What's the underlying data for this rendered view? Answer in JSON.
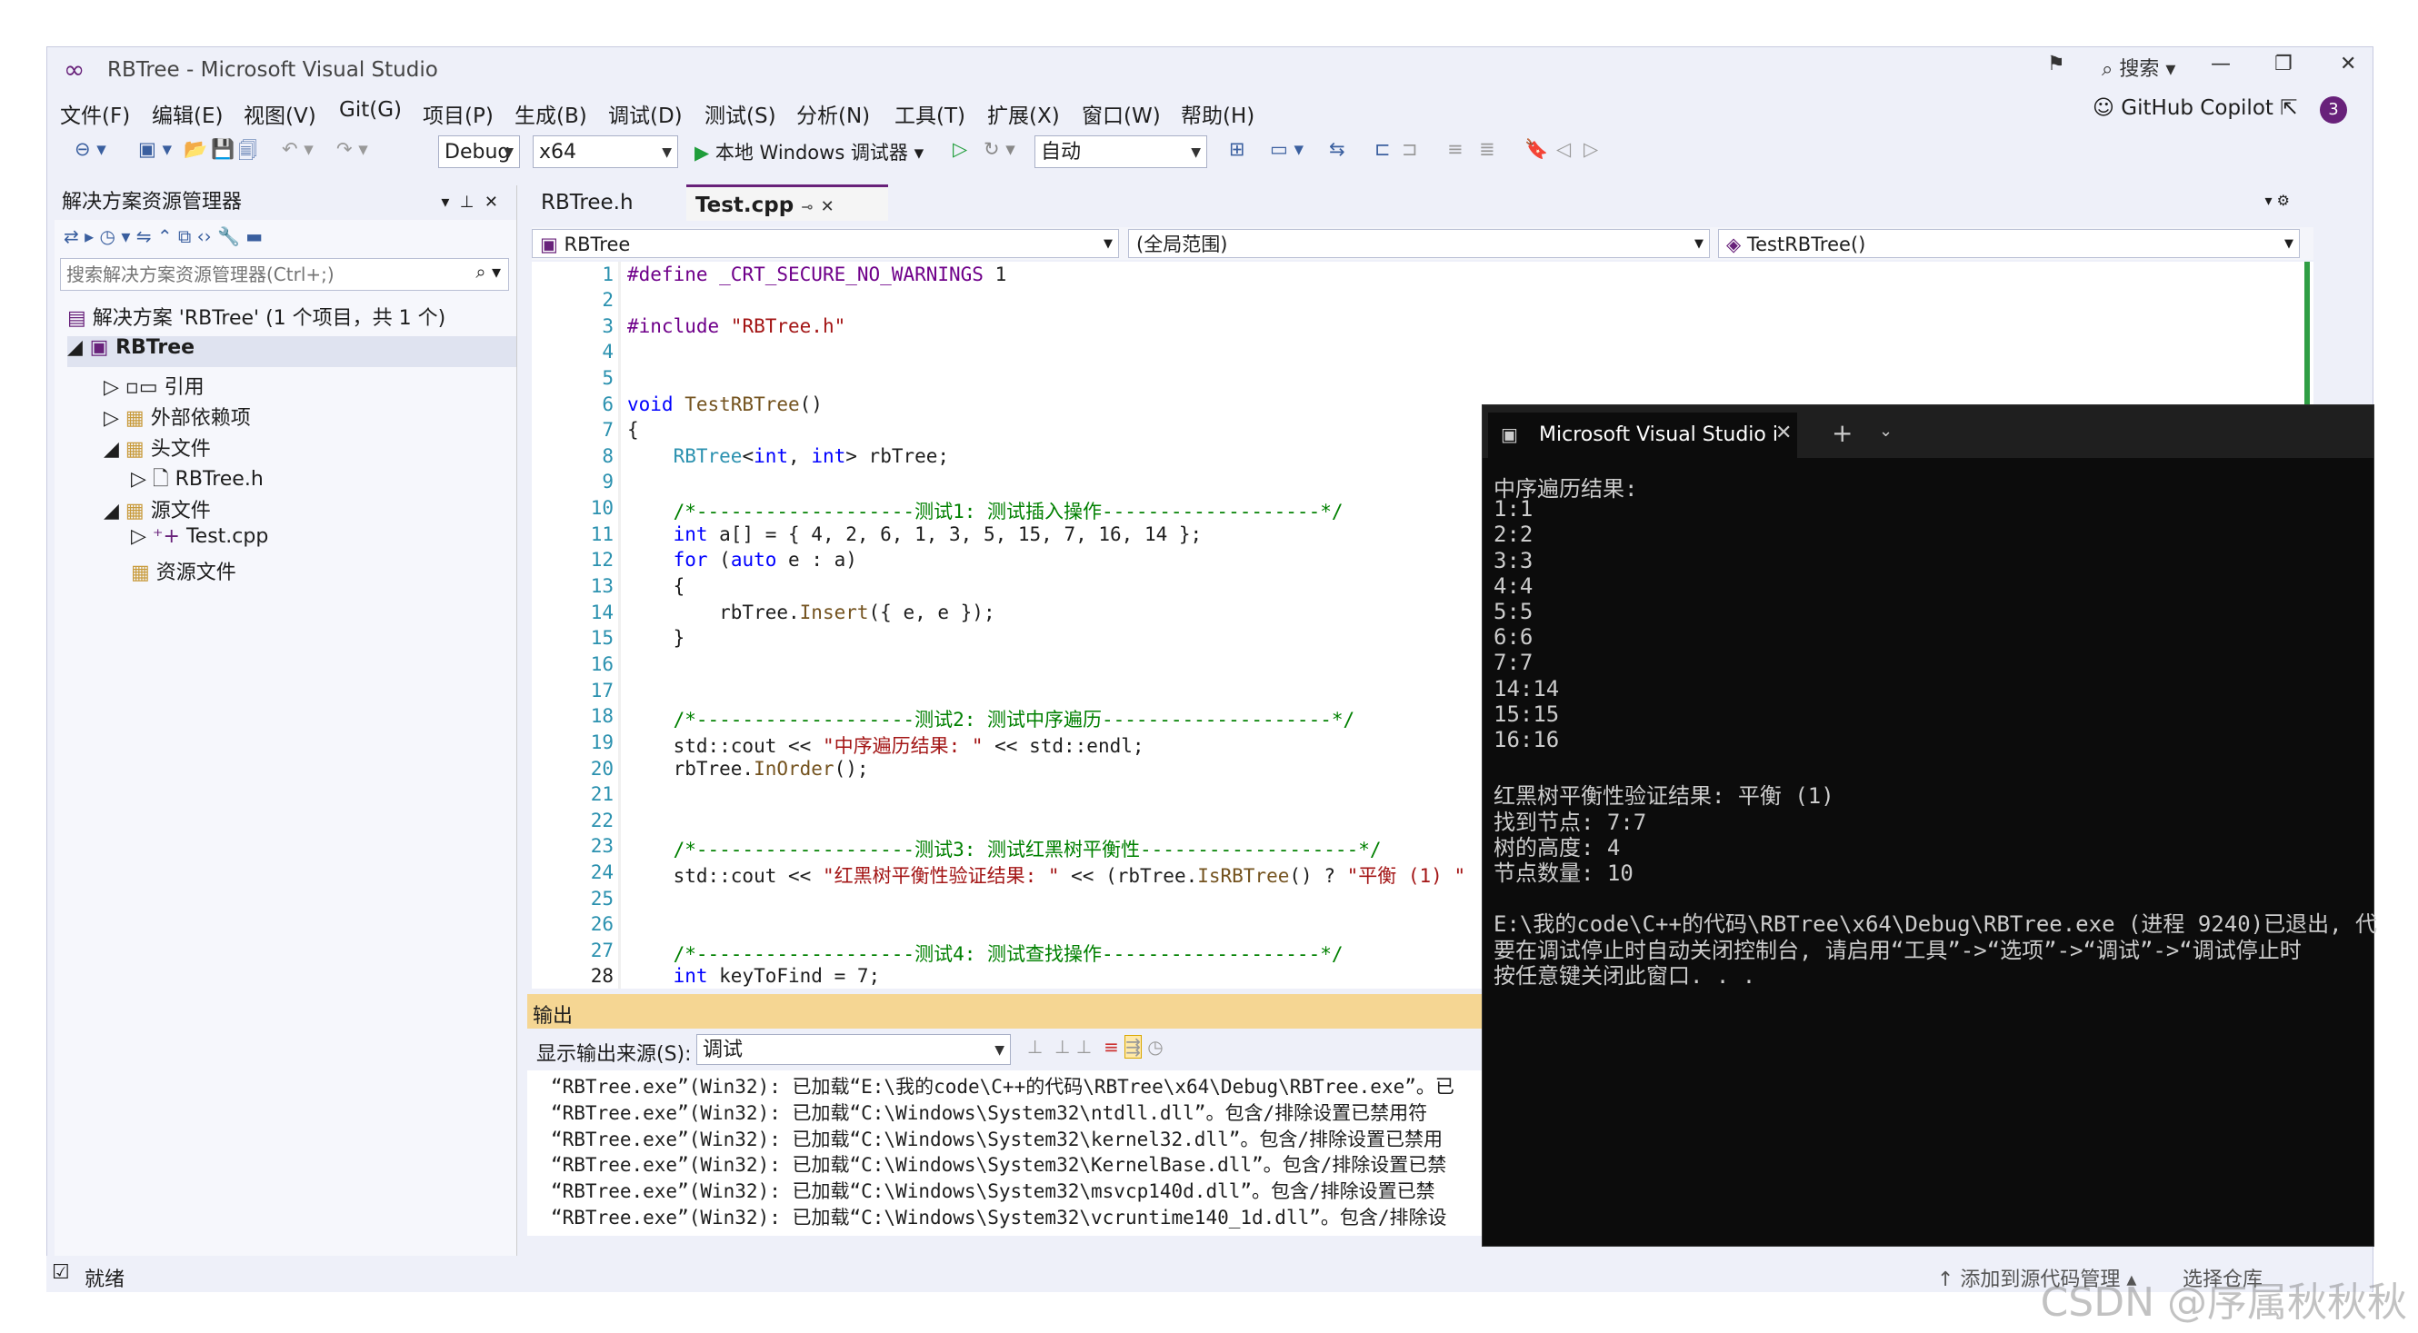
{
  "window": {
    "title": "RBTree - Microsoft Visual Studio",
    "search_label": "搜索",
    "copilot_label": "GitHub Copilot",
    "notification_count": "3",
    "minimize": "—",
    "restore": "❐",
    "close": "✕"
  },
  "menu": [
    "文件(F)",
    "编辑(E)",
    "视图(V)",
    "Git(G)",
    "项目(P)",
    "生成(B)",
    "调试(D)",
    "测试(S)",
    "分析(N)",
    "工具(T)",
    "扩展(X)",
    "窗口(W)",
    "帮助(H)"
  ],
  "toolbar": {
    "config": "Debug",
    "platform": "x64",
    "run_label": "本地 Windows 调试器",
    "auto_combo": "自动"
  },
  "solution_explorer": {
    "title": "解决方案资源管理器",
    "search_placeholder": "搜索解决方案资源管理器(Ctrl+;)",
    "items": [
      {
        "label": "解决方案 'RBTree' (1 个项目，共 1 个)"
      },
      {
        "label": "RBTree"
      },
      {
        "label": "引用"
      },
      {
        "label": "外部依赖项"
      },
      {
        "label": "头文件"
      },
      {
        "label": "RBTree.h"
      },
      {
        "label": "源文件"
      },
      {
        "label": "Test.cpp"
      },
      {
        "label": "资源文件"
      }
    ]
  },
  "editor": {
    "tabs": [
      {
        "label": "RBTree.h",
        "active": false
      },
      {
        "label": "Test.cpp",
        "active": true
      }
    ],
    "nav": {
      "project": "RBTree",
      "scope": "(全局范围)",
      "member": "TestRBTree()"
    },
    "line_numbers": [
      "1",
      "2",
      "3",
      "4",
      "5",
      "6",
      "7",
      "8",
      "9",
      "10",
      "11",
      "12",
      "13",
      "14",
      "15",
      "16",
      "17",
      "18",
      "19",
      "20",
      "21",
      "22",
      "23",
      "24",
      "25",
      "26",
      "27",
      "28"
    ],
    "code": {
      "l1a": "#define ",
      "l1b": "_CRT_SECURE_NO_WARNINGS",
      "l1c": " 1",
      "l3a": "#include ",
      "l3b": "\"RBTree.h\"",
      "l6a": "void ",
      "l6b": "TestRBTree",
      "l6c": "()",
      "l7": "{",
      "l8a": "    RBTree",
      "l8b": "<",
      "l8c": "int",
      "l8d": ", ",
      "l8e": "int",
      "l8f": "> rbTree;",
      "l10": "    /*-------------------测试1: 测试插入操作-------------------*/",
      "l11a": "    ",
      "l11b": "int",
      "l11c": " a[] = { 4, 2, 6, 1, 3, 5, 15, 7, 16, 14 };",
      "l12a": "    ",
      "l12b": "for",
      "l12c": " (",
      "l12d": "auto",
      "l12e": " e : a)",
      "l13": "    {",
      "l14a": "        rbTree.",
      "l14b": "Insert",
      "l14c": "({ e, e });",
      "l15": "    }",
      "l18": "    /*-------------------测试2: 测试中序遍历--------------------*/",
      "l19a": "    std::cout << ",
      "l19b": "\"中序遍历结果: \"",
      "l19c": " << std::endl;",
      "l20a": "    rbTree.",
      "l20b": "InOrder",
      "l20c": "();",
      "l23": "    /*-------------------测试3: 测试红黑树平衡性-------------------*/",
      "l24a": "    std::cout << ",
      "l24b": "\"红黑树平衡性验证结果: \"",
      "l24c": " << (rbTree.",
      "l24d": "IsRBTree",
      "l24e": "() ? ",
      "l24f": "\"平衡 (1) \"",
      "l27": "    /*-------------------测试4: 测试查找操作-------------------*/",
      "l28a": "    ",
      "l28b": "int",
      "l28c": " keyToFind = 7;"
    }
  },
  "output": {
    "title": "输出",
    "source_label": "显示输出来源(S):",
    "source_value": "调试",
    "lines": [
      "“RBTree.exe”(Win32): 已加载“E:\\我的code\\C++的代码\\RBTree\\x64\\Debug\\RBTree.exe”。已",
      "“RBTree.exe”(Win32): 已加载“C:\\Windows\\System32\\ntdll.dll”。包含/排除设置已禁用符",
      "“RBTree.exe”(Win32): 已加载“C:\\Windows\\System32\\kernel32.dll”。包含/排除设置已禁用",
      "“RBTree.exe”(Win32): 已加载“C:\\Windows\\System32\\KernelBase.dll”。包含/排除设置已禁",
      "“RBTree.exe”(Win32): 已加载“C:\\Windows\\System32\\msvcp140d.dll”。包含/排除设置已禁",
      "“RBTree.exe”(Win32): 已加载“C:\\Windows\\System32\\vcruntime140_1d.dll”。包含/排除设"
    ]
  },
  "console": {
    "tab_title": "Microsoft Visual Studio i",
    "lines": [
      "中序遍历结果:",
      "1:1",
      "2:2",
      "3:3",
      "4:4",
      "5:5",
      "6:6",
      "7:7",
      "14:14",
      "15:15",
      "16:16",
      "",
      "红黑树平衡性验证结果: 平衡 (1)",
      "找到节点: 7:7",
      "树的高度: 4",
      "节点数量: 10",
      "",
      "E:\\我的code\\C++的代码\\RBTree\\x64\\Debug\\RBTree.exe (进程 9240)已退出, 代",
      "要在调试停止时自动关闭控制台, 请启用“工具”->“选项”->“调试”->“调试停止时",
      "按任意键关闭此窗口. . ."
    ]
  },
  "status": {
    "ready": "就绪",
    "add_source": "↑ 添加到源代码管理 ▴",
    "select_repo": "选择仓库"
  },
  "watermark": "CSDN @序属秋秋秋",
  "colors": {
    "accent": "#68217a",
    "keyword": "#0000ff",
    "string": "#a31515",
    "comment": "#008000"
  }
}
